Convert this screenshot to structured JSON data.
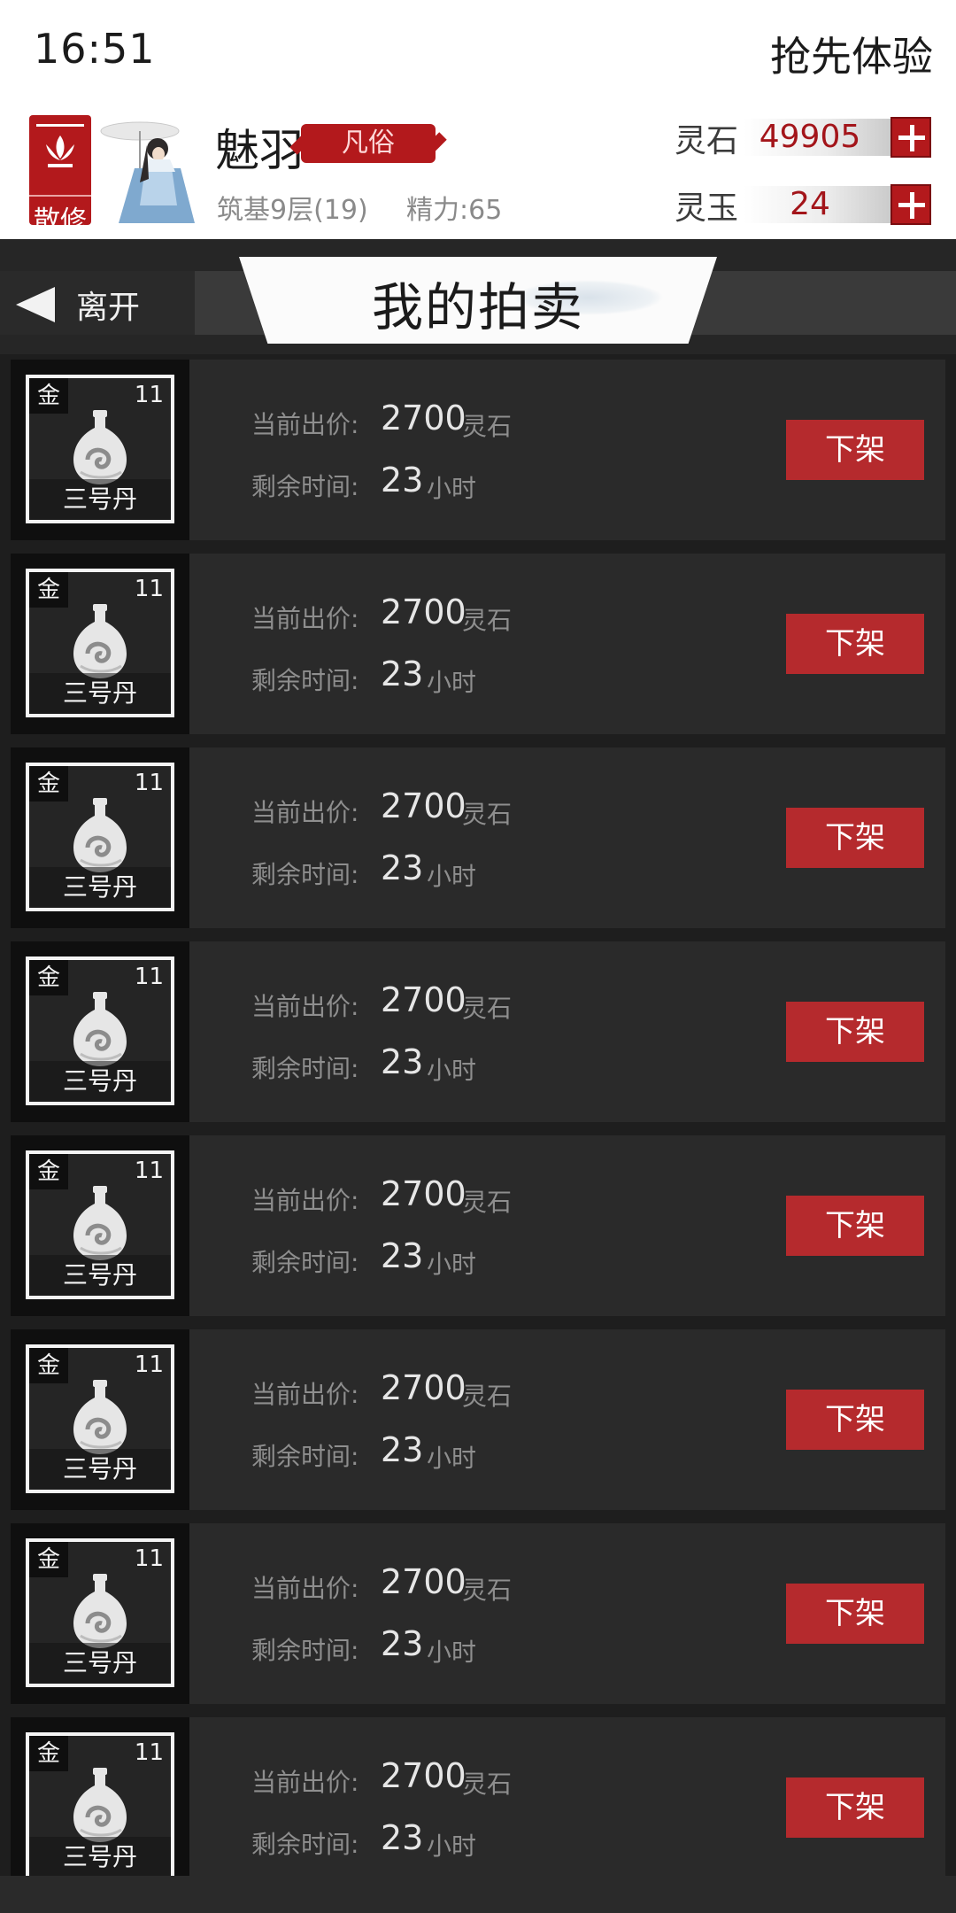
{
  "status_bar": {
    "time": "16:51",
    "right_text": "抢先体验"
  },
  "profile": {
    "sect_label": "散修",
    "name": "魅羽",
    "rank": "凡俗",
    "realm": "筑基9层(19)",
    "stamina": "精力:65"
  },
  "currencies": [
    {
      "label": "灵石",
      "value": "49905"
    },
    {
      "label": "灵玉",
      "value": "24"
    }
  ],
  "nav": {
    "leave_label": "离开",
    "title": "我的拍卖"
  },
  "labels": {
    "price": "当前出价:",
    "time": "剩余时间:",
    "price_unit": "灵石",
    "time_unit": "小时",
    "delist": "下架"
  },
  "listings": [
    {
      "grade": "金",
      "count": "11",
      "name": "三号丹",
      "price": "2700",
      "time": "23"
    },
    {
      "grade": "金",
      "count": "11",
      "name": "三号丹",
      "price": "2700",
      "time": "23"
    },
    {
      "grade": "金",
      "count": "11",
      "name": "三号丹",
      "price": "2700",
      "time": "23"
    },
    {
      "grade": "金",
      "count": "11",
      "name": "三号丹",
      "price": "2700",
      "time": "23"
    },
    {
      "grade": "金",
      "count": "11",
      "name": "三号丹",
      "price": "2700",
      "time": "23"
    },
    {
      "grade": "金",
      "count": "11",
      "name": "三号丹",
      "price": "2700",
      "time": "23"
    },
    {
      "grade": "金",
      "count": "11",
      "name": "三号丹",
      "price": "2700",
      "time": "23"
    },
    {
      "grade": "金",
      "count": "11",
      "name": "三号丹",
      "price": "2700",
      "time": "23"
    }
  ],
  "colors": {
    "accent_red": "#b3191c",
    "panel": "#2a2a2a",
    "background": "#1e1e1e"
  }
}
